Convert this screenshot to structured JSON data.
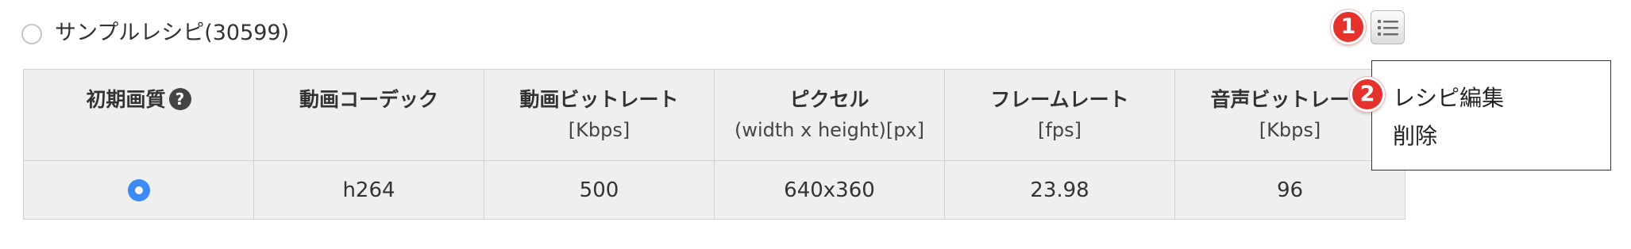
{
  "recipe": {
    "title": "サンプルレシピ(30599)"
  },
  "badges": {
    "one": "1",
    "two": "2"
  },
  "menu_button": {
    "icon": "list-icon"
  },
  "table": {
    "headers": [
      {
        "label": "初期画質",
        "unit": "",
        "help": "?"
      },
      {
        "label": "動画コーデック",
        "unit": ""
      },
      {
        "label": "動画ビットレート",
        "unit": "[Kbps]"
      },
      {
        "label": "ピクセル",
        "unit": "(width x height)[px]"
      },
      {
        "label": "フレームレート",
        "unit": "[fps]"
      },
      {
        "label": "音声ビットレート",
        "unit": "[Kbps]"
      }
    ],
    "row": {
      "default_quality_selected": true,
      "codec": "h264",
      "video_bitrate": "500",
      "pixels": "640x360",
      "frame_rate": "23.98",
      "audio_bitrate": "96"
    }
  },
  "context_menu": {
    "items": [
      "レシピ編集",
      "削除"
    ]
  },
  "colors": {
    "badge": "#e5322d",
    "selected_radio": "#3b8af6",
    "table_bg": "#efefef",
    "table_border": "#d2d2d2"
  }
}
